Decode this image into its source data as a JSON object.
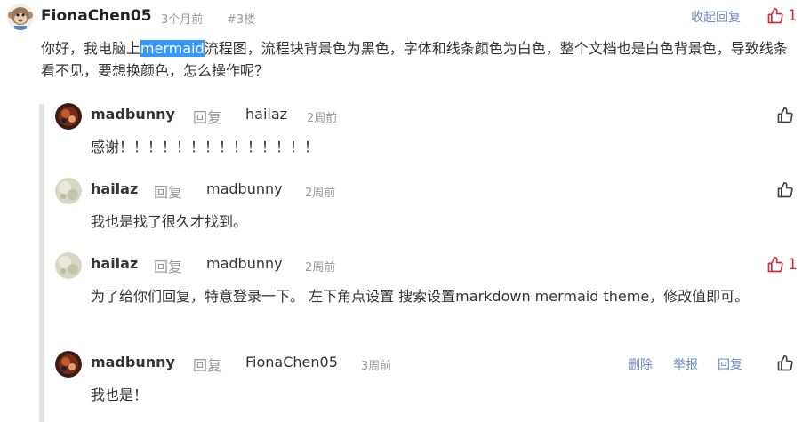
{
  "main_comment": {
    "username": "FionaChen05",
    "time": "3个月前",
    "floor": "#3楼",
    "collapse_label": "收起回复",
    "like_count": "1",
    "content_before": "你好，我电脑上",
    "content_highlight": "mermaid",
    "content_after": "流程图，流程块背景色为黑色，字体和线条颜色为白色，整个文档也是白色背景色，导致线条看不见，要想换颜色，怎么操作呢？"
  },
  "replies": [
    {
      "username": "madbunny",
      "reply_word": "回复",
      "target": "hailaz",
      "time": "2周前",
      "content": "感谢！！！！！！！！！！！！！！"
    },
    {
      "username": "hailaz",
      "reply_word": "回复",
      "target": "madbunny",
      "time": "2周前",
      "content": "我也是找了很久才找到。"
    },
    {
      "username": "hailaz",
      "reply_word": "回复",
      "target": "madbunny",
      "time": "2周前",
      "like_count": "1",
      "content": "为了给你们回复，特意登录一下。 左下角点设置 搜索设置markdown mermaid theme，修改值即可。"
    },
    {
      "username": "madbunny",
      "reply_word": "回复",
      "target": "FionaChen05",
      "time": "3周前",
      "delete_label": "删除",
      "report_label": "举报",
      "reply_label": "回复",
      "content": "我也是！"
    }
  ],
  "colors": {
    "link": "#6d8bc2",
    "like_active": "#d0303c",
    "highlight": "#3399ff",
    "thread_bar": "#e4e4e4"
  }
}
